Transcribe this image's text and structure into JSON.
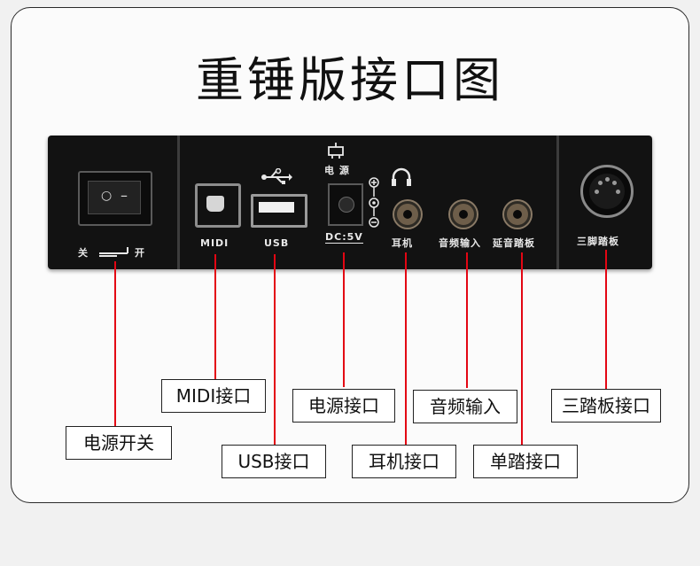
{
  "title": "重锤版接口图",
  "panel_labels": {
    "power_switch_off": "关",
    "power_switch_on": "开",
    "midi": "MIDI",
    "usb": "USB",
    "power": "电 源",
    "dc": "DC:5V",
    "headphone": "耳机",
    "audio_in": "音频输入",
    "sustain_pedal": "延音踏板",
    "three_pedal": "三脚踏板"
  },
  "callouts": {
    "power_switch": "电源开关",
    "midi": "MIDI接口",
    "usb": "USB接口",
    "power": "电源接口",
    "headphone": "耳机接口",
    "audio_in": "音频输入",
    "single_pedal": "单踏接口",
    "three_pedal": "三踏板接口"
  },
  "colors": {
    "line": "#e30613",
    "panel": "#121212"
  },
  "icons": [
    "power-switch-icon",
    "usb-symbol-icon",
    "power-plug-icon",
    "polarity-icon",
    "headphone-icon"
  ]
}
